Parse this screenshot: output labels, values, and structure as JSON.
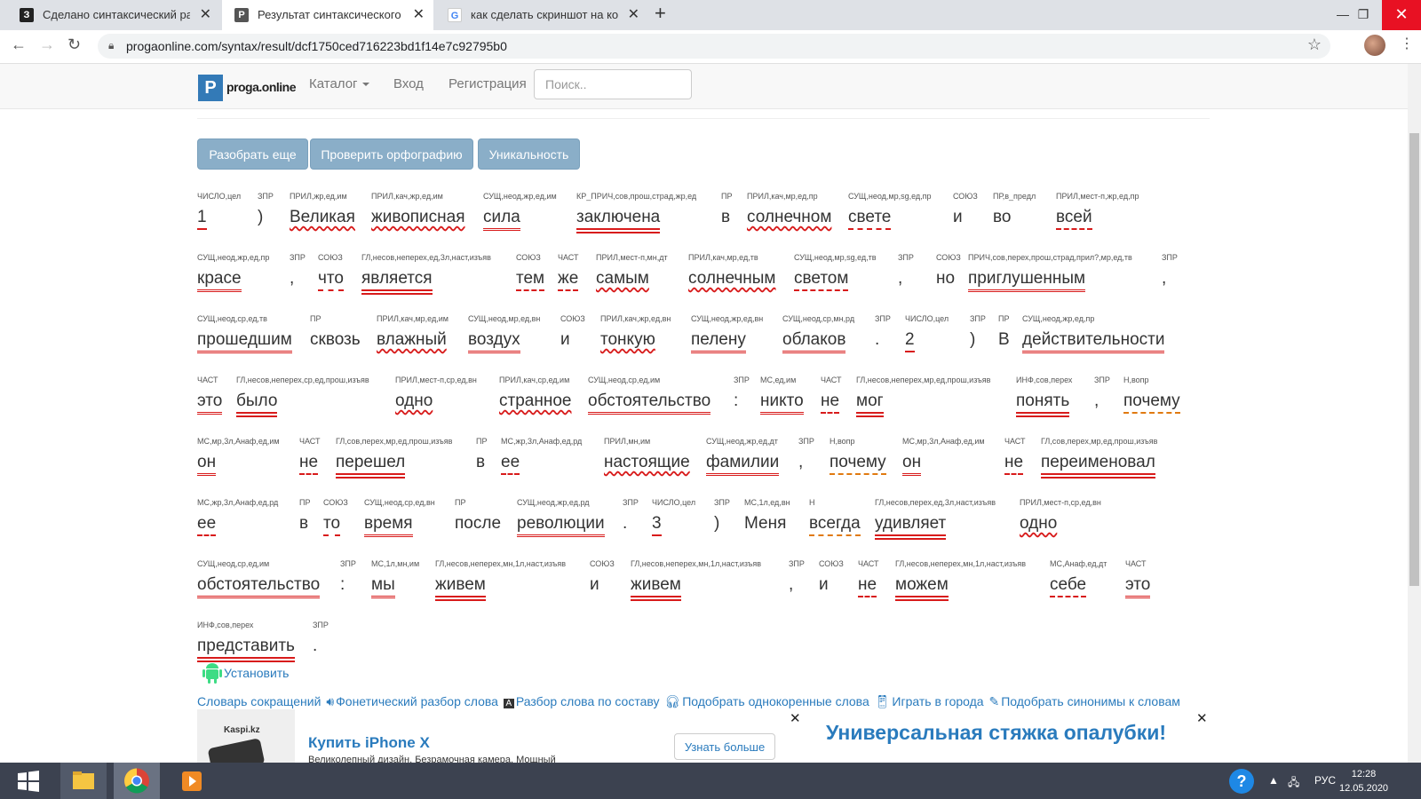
{
  "browser": {
    "tabs": [
      {
        "label": "Сделано синтаксический разбор",
        "favicon": "З"
      },
      {
        "label": "Результат синтаксического и м",
        "favicon": "P"
      },
      {
        "label": "как сделать скриншот на компь",
        "favicon": "G"
      }
    ],
    "url": "progaonline.com/syntax/result/dcf1750ced716223bd1f14e7c92795b0"
  },
  "site": {
    "logo_letter": "P",
    "logo_name": "proga.online",
    "nav": {
      "catalog": "Каталог",
      "login": "Вход",
      "register": "Регистрация"
    },
    "search_placeholder": "Поиск..",
    "buttons": {
      "again": "Разобрать еще",
      "spell": "Проверить орфографию",
      "unique": "Уникальность"
    }
  },
  "tokens": [
    {
      "tag": "ЧИСЛО,цел",
      "word": "1"
    },
    {
      "tag": "ЗПР",
      "word": ")"
    },
    {
      "tag": "ПРИЛ,жр,ед,им",
      "word": "Великая"
    },
    {
      "tag": "ПРИЛ,кач,жр,ед,им",
      "word": "живописная"
    },
    {
      "tag": "СУЩ,неод,жр,ед,им",
      "word": "сила"
    },
    {
      "tag": "КР_ПРИЧ,сов,прош,страд,жр,ед",
      "word": "заключена"
    },
    {
      "tag": "ПР",
      "word": "в"
    },
    {
      "tag": "ПРИЛ,кач,мр,ед,пр",
      "word": "солнечном"
    },
    {
      "tag": "СУЩ,неод,мр,sg,ед,пр",
      "word": "свете"
    },
    {
      "tag": "СОЮЗ",
      "word": "и"
    },
    {
      "tag": "ПР,в_предл",
      "word": "во"
    },
    {
      "tag": "ПРИЛ,мест-п,жр,ед,пр",
      "word": "всей"
    },
    {
      "tag": "СУЩ,неод,жр,ед,пр",
      "word": "красе"
    },
    {
      "tag": "ЗПР",
      "word": ","
    },
    {
      "tag": "СОЮЗ",
      "word": "что"
    },
    {
      "tag": "ГЛ,несов,неперех,ед,3л,наст,изъяв",
      "word": "является"
    },
    {
      "tag": "СОЮЗ",
      "word": "тем"
    },
    {
      "tag": "ЧАСТ",
      "word": "же"
    },
    {
      "tag": "ПРИЛ,мест-п,мн,дт",
      "word": "самым"
    },
    {
      "tag": "ПРИЛ,кач,мр,ед,тв",
      "word": "солнечным"
    },
    {
      "tag": "СУЩ,неод,мр,sg,ед,тв",
      "word": "светом"
    },
    {
      "tag": "ЗПР",
      "word": ","
    },
    {
      "tag": "СОЮЗ",
      "word": "но"
    },
    {
      "tag": "ПРИЧ,сов,перех,прош,страд,прил?,мр,ед,тв",
      "word": "приглушенным"
    },
    {
      "tag": "ЗПР",
      "word": ","
    },
    {
      "tag": "СУЩ,неод,ср,ед,тв",
      "word": "прошедшим"
    },
    {
      "tag": "ПР",
      "word": "сквозь"
    },
    {
      "tag": "ПРИЛ,кач,мр,ед,им",
      "word": "влажный"
    },
    {
      "tag": "СУЩ,неод,мр,ед,вн",
      "word": "воздух"
    },
    {
      "tag": "СОЮЗ",
      "word": "и"
    },
    {
      "tag": "ПРИЛ,кач,жр,ед,вн",
      "word": "тонкую"
    },
    {
      "tag": "СУЩ,неод,жр,ед,вн",
      "word": "пелену"
    },
    {
      "tag": "СУЩ,неод,ср,мн,рд",
      "word": "облаков"
    },
    {
      "tag": "ЗПР",
      "word": "."
    },
    {
      "tag": "ЧИСЛО,цел",
      "word": "2"
    },
    {
      "tag": "ЗПР",
      "word": ")"
    },
    {
      "tag": "ПР",
      "word": "В"
    },
    {
      "tag": "СУЩ,неод,жр,ед,пр",
      "word": "действительности"
    },
    {
      "tag": "ЧАСТ",
      "word": "это"
    },
    {
      "tag": "ГЛ,несов,неперех,ср,ед,прош,изъяв",
      "word": "было"
    },
    {
      "tag": "ПРИЛ,мест-п,ср,ед,вн",
      "word": "одно"
    },
    {
      "tag": "ПРИЛ,кач,ср,ед,им",
      "word": "странное"
    },
    {
      "tag": "СУЩ,неод,ср,ед,им",
      "word": "обстоятельство"
    },
    {
      "tag": "ЗПР",
      "word": ":"
    },
    {
      "tag": "МС,ед,им",
      "word": "никто"
    },
    {
      "tag": "ЧАСТ",
      "word": "не"
    },
    {
      "tag": "ГЛ,несов,неперех,мр,ед,прош,изъяв",
      "word": "мог"
    },
    {
      "tag": "ИНФ,сов,перех",
      "word": "понять"
    },
    {
      "tag": "ЗПР",
      "word": ","
    },
    {
      "tag": "Н,вопр",
      "word": "почему"
    },
    {
      "tag": "МС,мр,3л,Анаф,ед,им",
      "word": "он"
    },
    {
      "tag": "ЧАСТ",
      "word": "не"
    },
    {
      "tag": "ГЛ,сов,перех,мр,ед,прош,изъяв",
      "word": "перешел"
    },
    {
      "tag": "ПР",
      "word": "в"
    },
    {
      "tag": "МС,жр,3л,Анаф,ед,рд",
      "word": "ее"
    },
    {
      "tag": "ПРИЛ,мн,им",
      "word": "настоящие"
    },
    {
      "tag": "СУЩ,неод,жр,ед,дт",
      "word": "фамилии"
    },
    {
      "tag": "ЗПР",
      "word": ","
    },
    {
      "tag": "Н,вопр",
      "word": "почему"
    },
    {
      "tag": "МС,мр,3л,Анаф,ед,им",
      "word": "он"
    },
    {
      "tag": "ЧАСТ",
      "word": "не"
    },
    {
      "tag": "ГЛ,сов,перех,мр,ед,прош,изъяв",
      "word": "переименовал"
    },
    {
      "tag": "МС,жр,3л,Анаф,ед,рд",
      "word": "ее"
    },
    {
      "tag": "ПР",
      "word": "в"
    },
    {
      "tag": "СОЮЗ",
      "word": "то"
    },
    {
      "tag": "СУЩ,неод,ср,ед,вн",
      "word": "время"
    },
    {
      "tag": "ПР",
      "word": "после"
    },
    {
      "tag": "СУЩ,неод,жр,ед,рд",
      "word": "революции"
    },
    {
      "tag": "ЗПР",
      "word": "."
    },
    {
      "tag": "ЧИСЛО,цел",
      "word": "3"
    },
    {
      "tag": "ЗПР",
      "word": ")"
    },
    {
      "tag": "МС,1л,ед,вн",
      "word": "Меня"
    },
    {
      "tag": "Н",
      "word": "всегда"
    },
    {
      "tag": "ГЛ,несов,перех,ед,3л,наст,изъяв",
      "word": "удивляет"
    },
    {
      "tag": "ПРИЛ,мест-п,ср,ед,вн",
      "word": "одно"
    },
    {
      "tag": "СУЩ,неод,ср,ед,им",
      "word": "обстоятельство"
    },
    {
      "tag": "ЗПР",
      "word": ":"
    },
    {
      "tag": "МС,1л,мн,им",
      "word": "мы"
    },
    {
      "tag": "ГЛ,несов,неперех,мн,1л,наст,изъяв",
      "word": "живем"
    },
    {
      "tag": "СОЮЗ",
      "word": "и"
    },
    {
      "tag": "ГЛ,несов,неперех,мн,1л,наст,изъяв",
      "word": "живем"
    },
    {
      "tag": "ЗПР",
      "word": ","
    },
    {
      "tag": "СОЮЗ",
      "word": "и"
    },
    {
      "tag": "ЧАСТ",
      "word": "не"
    },
    {
      "tag": "ГЛ,несов,неперех,мн,1л,наст,изъяв",
      "word": "можем"
    },
    {
      "tag": "МС,Анаф,ед,дт",
      "word": "себе"
    },
    {
      "tag": "ЧАСТ",
      "word": "это"
    },
    {
      "tag": "ИНФ,сов,перех",
      "word": "представить"
    },
    {
      "tag": "ЗПР",
      "word": "."
    }
  ],
  "bottom": {
    "install": "Установить",
    "links": [
      "Словарь сокращений",
      "Фонетический разбор слова",
      "Разбор слова по составу",
      "Подобрать однокоренные слова",
      "Играть в города",
      "Подобрать синонимы к словам"
    ],
    "ad1": {
      "brand": "Kaspi.kz",
      "title": "Купить iPhone X",
      "text": "Великолепный дизайн. Безрамочная камера. Мощный",
      "button": "Узнать больше"
    },
    "ad2": {
      "title": "Универсальная стяжка опалубки!"
    }
  },
  "taskbar": {
    "lang": "РУС",
    "time": "12:28",
    "date": "12.05.2020"
  }
}
